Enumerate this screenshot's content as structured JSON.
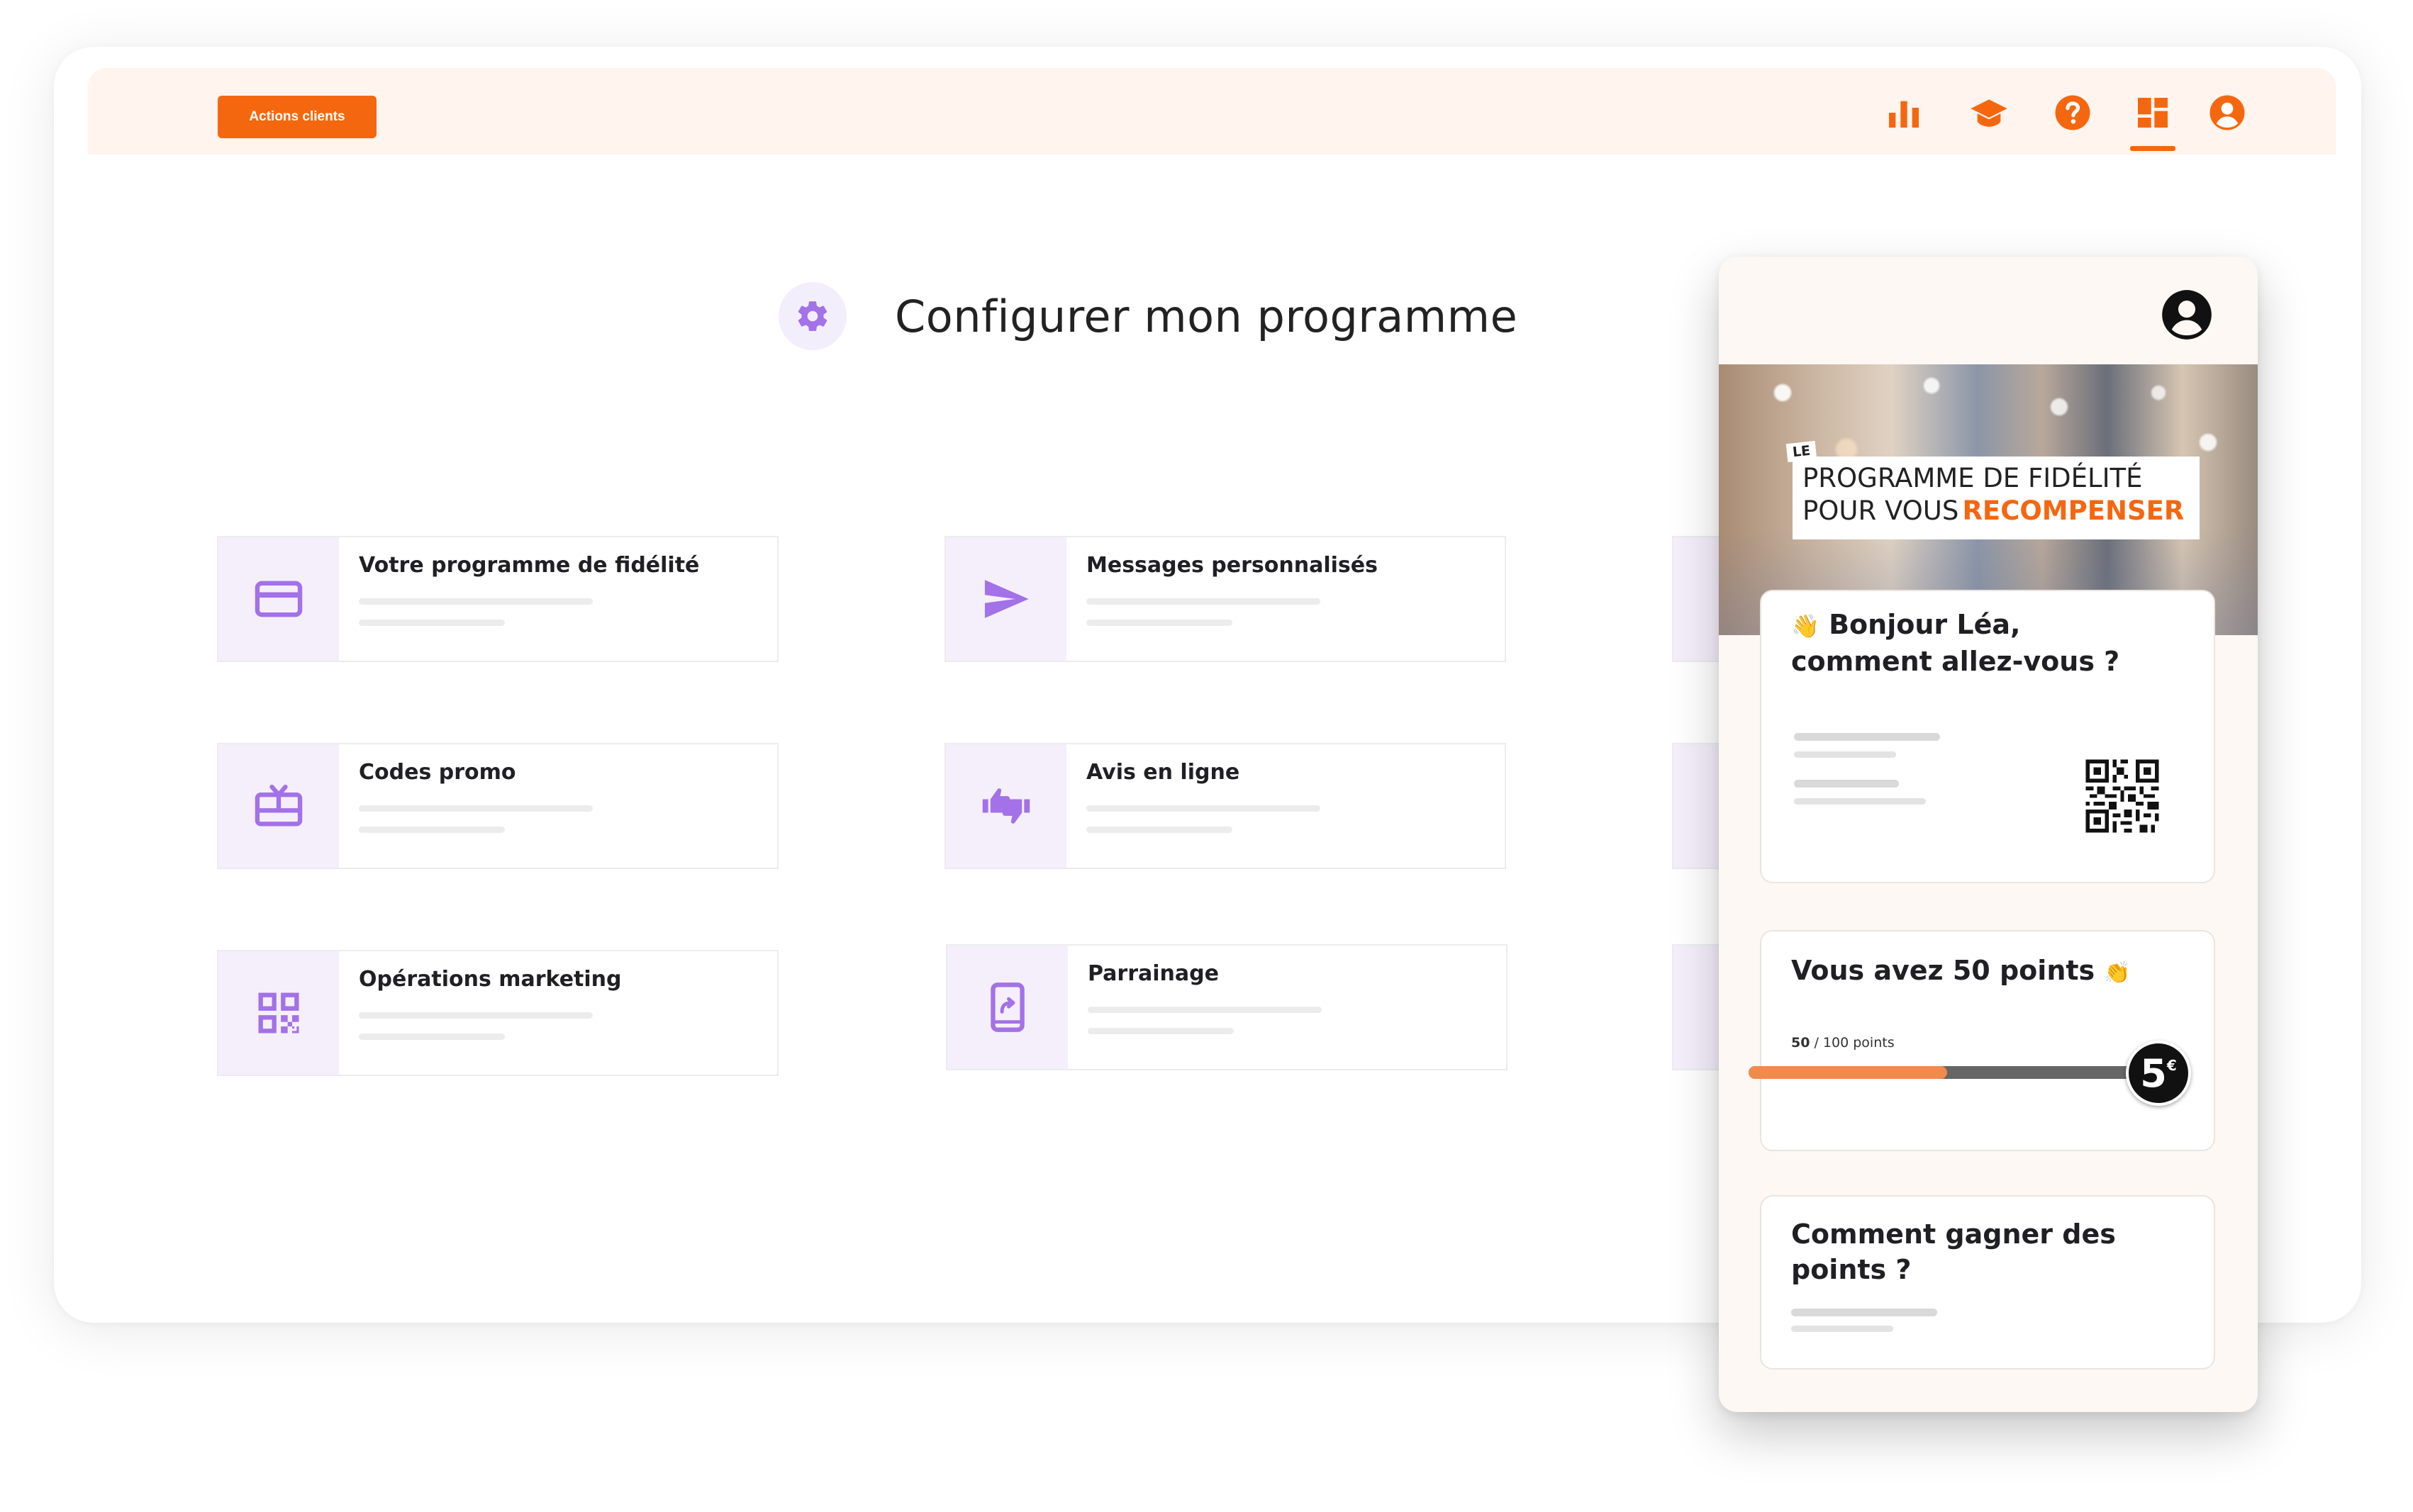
{
  "header": {
    "actions_label": "Actions clients",
    "icons": [
      "bar-chart-icon",
      "graduation-cap-icon",
      "help-icon",
      "dashboard-icon",
      "account-icon"
    ],
    "accent_color": "#f5670f"
  },
  "page": {
    "title": "Configurer mon programme"
  },
  "cards": [
    {
      "label": "Votre programme de fidélité",
      "icon": "credit-card-icon"
    },
    {
      "label": "Messages personnalisés",
      "icon": "send-icon"
    },
    {
      "label": "Codes promo",
      "icon": "gift-card-icon"
    },
    {
      "label": "Avis en ligne",
      "icon": "thumbs-up-down-icon"
    },
    {
      "label": "Opérations marketing",
      "icon": "qr-code-icon"
    },
    {
      "label": "Parrainage",
      "icon": "share-phone-icon"
    }
  ],
  "phone": {
    "banner": {
      "tag_small": "LE",
      "line1": "PROGRAMME DE FIDÉLITÉ",
      "line2_prefix": "POUR VOUS",
      "line2_highlight": "RECOMPENSER"
    },
    "greeting": {
      "emoji": "👋",
      "text_line1": "Bonjour Léa,",
      "text_line2": "comment allez-vous ?"
    },
    "points": {
      "title": "Vous avez 50 points",
      "emoji": "👏",
      "current": "50",
      "total_text": " / 100 points",
      "progress_fraction": 0.5,
      "reward_value": "5",
      "reward_unit": "€"
    },
    "earn": {
      "title_line1": "Comment gagner des",
      "title_line2": "points ?"
    }
  }
}
